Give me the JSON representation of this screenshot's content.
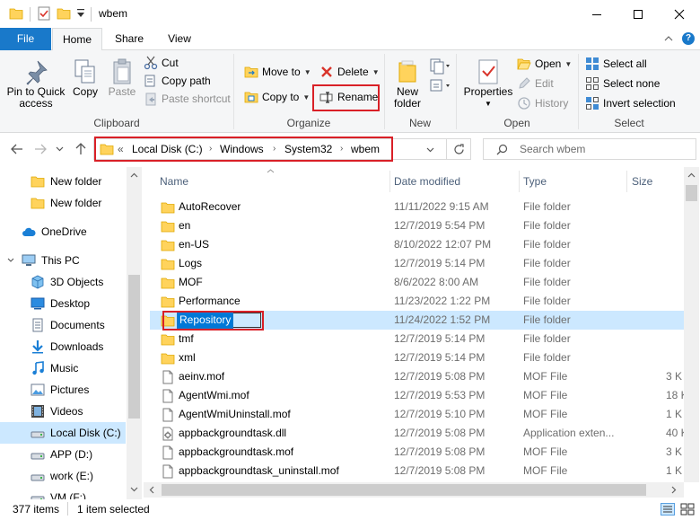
{
  "window": {
    "title": "wbem"
  },
  "tabs": {
    "file": "File",
    "home": "Home",
    "share": "Share",
    "view": "View"
  },
  "ribbon": {
    "clipboard": {
      "label": "Clipboard",
      "pin": "Pin to Quick\naccess",
      "pin_l1": "Pin to Quick",
      "pin_l2": "access",
      "copy": "Copy",
      "paste": "Paste",
      "cut": "Cut",
      "copy_path": "Copy path",
      "paste_shortcut": "Paste shortcut"
    },
    "organize": {
      "label": "Organize",
      "move_to": "Move to",
      "copy_to": "Copy to",
      "delete": "Delete",
      "rename": "Rename"
    },
    "new": {
      "label": "New",
      "new_folder_l1": "New",
      "new_folder_l2": "folder"
    },
    "open": {
      "label": "Open",
      "properties": "Properties",
      "open": "Open",
      "edit": "Edit",
      "history": "History"
    },
    "select": {
      "label": "Select",
      "select_all": "Select all",
      "select_none": "Select none",
      "invert": "Invert selection"
    }
  },
  "address": {
    "overflow": "«",
    "crumbs": [
      "Local Disk (C:)",
      "Windows",
      "System32",
      "wbem"
    ],
    "search_placeholder": "Search wbem"
  },
  "nav": {
    "items": [
      {
        "label": "New folder",
        "icon": "folder-icon"
      },
      {
        "label": "New folder",
        "icon": "folder-icon"
      },
      {
        "label": "OneDrive",
        "icon": "cloud-icon"
      },
      {
        "label": "This PC",
        "icon": "computer-icon"
      },
      {
        "label": "3D Objects",
        "icon": "cube-icon"
      },
      {
        "label": "Desktop",
        "icon": "desktop-icon"
      },
      {
        "label": "Documents",
        "icon": "documents-icon"
      },
      {
        "label": "Downloads",
        "icon": "download-icon"
      },
      {
        "label": "Music",
        "icon": "music-icon"
      },
      {
        "label": "Pictures",
        "icon": "pictures-icon"
      },
      {
        "label": "Videos",
        "icon": "videos-icon"
      },
      {
        "label": "Local Disk (C:)",
        "icon": "drive-icon"
      },
      {
        "label": "APP (D:)",
        "icon": "drive-icon"
      },
      {
        "label": "work (E:)",
        "icon": "drive-icon"
      },
      {
        "label": "VM (F:)",
        "icon": "drive-icon"
      }
    ]
  },
  "columns": {
    "name": "Name",
    "date": "Date modified",
    "type": "Type",
    "size": "Size"
  },
  "files": [
    {
      "name": "AutoRecover",
      "date": "11/11/2022 9:15 AM",
      "type": "File folder",
      "size": "",
      "kind": "folder"
    },
    {
      "name": "en",
      "date": "12/7/2019 5:54 PM",
      "type": "File folder",
      "size": "",
      "kind": "folder"
    },
    {
      "name": "en-US",
      "date": "8/10/2022 12:07 PM",
      "type": "File folder",
      "size": "",
      "kind": "folder"
    },
    {
      "name": "Logs",
      "date": "12/7/2019 5:14 PM",
      "type": "File folder",
      "size": "",
      "kind": "folder"
    },
    {
      "name": "MOF",
      "date": "8/6/2022 8:00 AM",
      "type": "File folder",
      "size": "",
      "kind": "folder"
    },
    {
      "name": "Performance",
      "date": "11/23/2022 1:22 PM",
      "type": "File folder",
      "size": "",
      "kind": "folder"
    },
    {
      "name": "Repository",
      "date": "11/24/2022 1:52 PM",
      "type": "File folder",
      "size": "",
      "kind": "folder"
    },
    {
      "name": "tmf",
      "date": "12/7/2019 5:14 PM",
      "type": "File folder",
      "size": "",
      "kind": "folder"
    },
    {
      "name": "xml",
      "date": "12/7/2019 5:14 PM",
      "type": "File folder",
      "size": "",
      "kind": "folder"
    },
    {
      "name": "aeinv.mof",
      "date": "12/7/2019 5:08 PM",
      "type": "MOF File",
      "size": "3 K",
      "kind": "file"
    },
    {
      "name": "AgentWmi.mof",
      "date": "12/7/2019 5:53 PM",
      "type": "MOF File",
      "size": "18 K",
      "kind": "file"
    },
    {
      "name": "AgentWmiUninstall.mof",
      "date": "12/7/2019 5:10 PM",
      "type": "MOF File",
      "size": "1 K",
      "kind": "file"
    },
    {
      "name": "appbackgroundtask.dll",
      "date": "12/7/2019 5:08 PM",
      "type": "Application exten...",
      "size": "40 K",
      "kind": "dll"
    },
    {
      "name": "appbackgroundtask.mof",
      "date": "12/7/2019 5:08 PM",
      "type": "MOF File",
      "size": "3 K",
      "kind": "file"
    },
    {
      "name": "appbackgroundtask_uninstall.mof",
      "date": "12/7/2019 5:08 PM",
      "type": "MOF File",
      "size": "1 K",
      "kind": "file"
    }
  ],
  "status": {
    "items": "377 items",
    "selected": "1 item selected"
  },
  "colors": {
    "accent": "#1979ca",
    "selection": "#cce8ff",
    "folder": "#ffd35c",
    "highlight": "#d92027"
  }
}
